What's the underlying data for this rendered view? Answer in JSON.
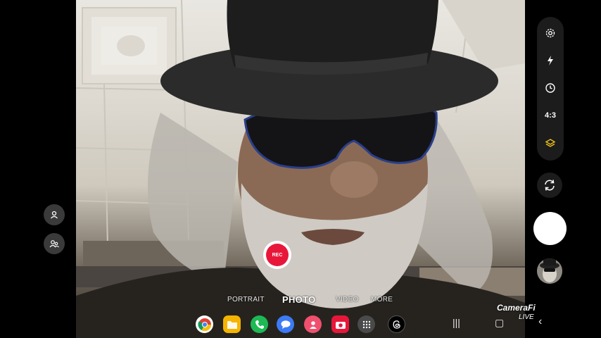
{
  "camera": {
    "modes": [
      "PORTRAIT",
      "PHOTO",
      "VIDEO",
      "MORE"
    ],
    "active_mode": "PHOTO",
    "aspect_ratio": "4:3",
    "rec_label": "REC",
    "accent_rec": "#e8173a",
    "accent_layer": "#f0c419"
  },
  "left_controls": {
    "items": [
      {
        "icon": "single-person-icon"
      },
      {
        "icon": "multi-person-icon"
      }
    ]
  },
  "right_controls": {
    "items": [
      {
        "icon": "gear-icon"
      },
      {
        "icon": "flash-icon"
      },
      {
        "icon": "timer-icon"
      },
      {
        "icon": "aspect-ratio-label"
      },
      {
        "icon": "layers-icon"
      }
    ]
  },
  "dock": {
    "apps": [
      {
        "name": "chrome-icon",
        "color": "#ffffff"
      },
      {
        "name": "files-icon",
        "color": "#f5b400"
      },
      {
        "name": "phone-icon",
        "color": "#1db954"
      },
      {
        "name": "messages-icon",
        "color": "#3d7bf5"
      },
      {
        "name": "contacts-icon",
        "color": "#f0506e"
      },
      {
        "name": "camera-app-icon",
        "color": "#e8173a"
      },
      {
        "name": "app-drawer-icon",
        "color": "#4a4a4a"
      },
      {
        "name": "threads-icon",
        "color": "#000000"
      }
    ]
  },
  "watermark": {
    "brand": "CameraFi",
    "sub": "LIVE"
  }
}
